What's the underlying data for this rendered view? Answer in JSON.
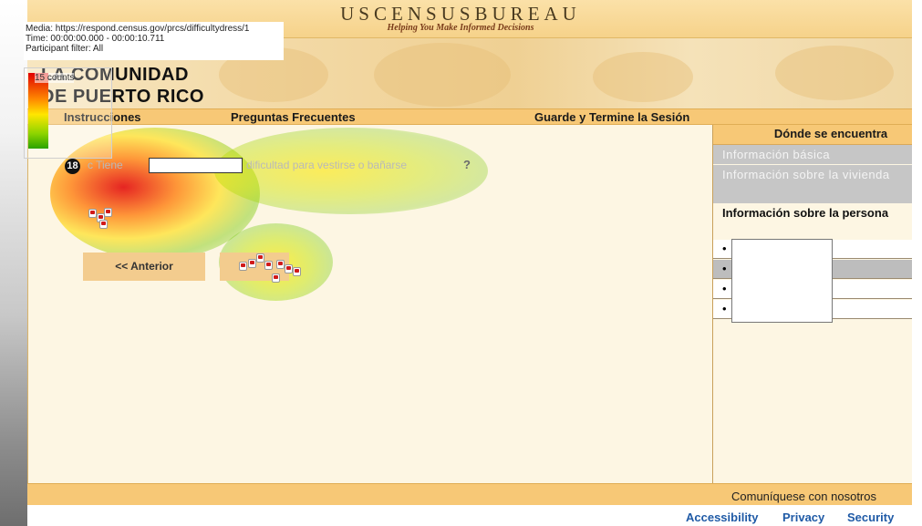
{
  "overlay": {
    "media": "Media: https://respond.census.gov/prcs/difficultydress/1",
    "time": "Time: 00:00:00.000 - 00:00:10.711",
    "filter": "Participant filter: All",
    "legend_label": "15 counts"
  },
  "header": {
    "bureau": "USCENSUSBUREAU",
    "tagline": "Helping You Make Informed Decisions",
    "banner_line1": "LA COMUNIDAD",
    "banner_line2": "DE PUERTO RICO"
  },
  "nav": {
    "instrucciones": "Instrucciones",
    "preguntas": "Preguntas Frecuentes",
    "guarde": "Guarde y Termine la Sesión"
  },
  "panel": {
    "title": "Dónde se encuentra",
    "item_basica": "Información básica",
    "item_vivienda": "Información sobre la vivienda",
    "item_persona": "Información sobre la persona",
    "bullet": "•"
  },
  "question": {
    "number": "18",
    "prefix": "c",
    "fragment_a": "Tiene",
    "fragment_b": "dificultad para vestirse o bañarse",
    "end": "?"
  },
  "buttons": {
    "prev": "<<  Anterior"
  },
  "footer": {
    "contact": "Comuníquese con nosotros",
    "accessibility": "Accessibility",
    "privacy": "Privacy",
    "security": "Security"
  },
  "colors": {
    "nav_bg": "#f7c876",
    "frame_bg": "#fdf6e3",
    "link": "#1f5aa6",
    "heat_hot": "#e10000",
    "heat_cool": "#2aa300"
  }
}
